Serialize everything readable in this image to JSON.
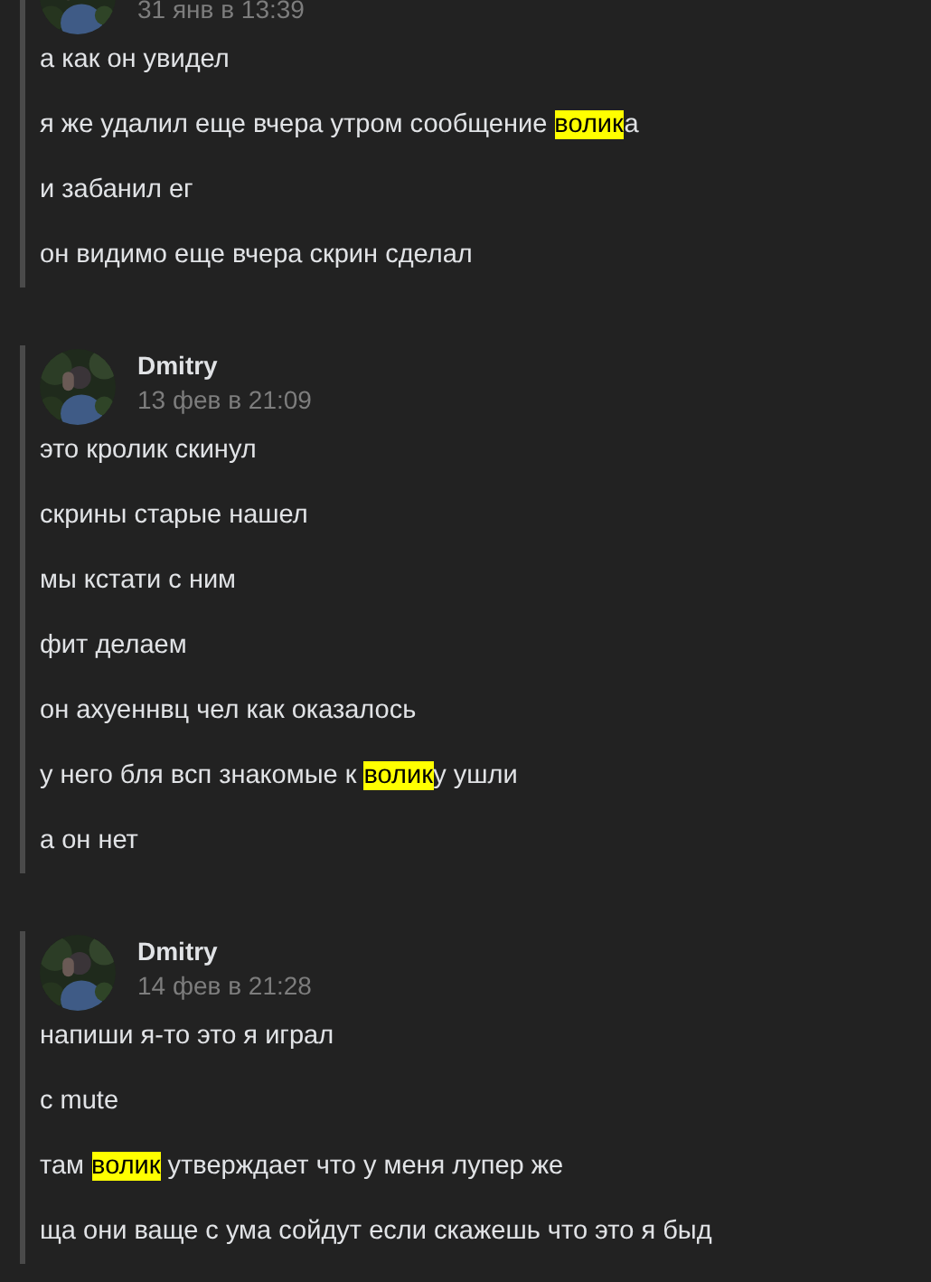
{
  "groups": [
    {
      "time": "31 янв в 13:39",
      "messages": [
        {
          "segments": [
            {
              "text": "а как он увидел",
              "highlight": false
            }
          ]
        },
        {
          "segments": [
            {
              "text": "я же удалил еще вчера утром сообщение ",
              "highlight": false
            },
            {
              "text": "волик",
              "highlight": true
            },
            {
              "text": "а",
              "highlight": false
            }
          ]
        },
        {
          "segments": [
            {
              "text": "и забанил ег",
              "highlight": false
            }
          ]
        },
        {
          "segments": [
            {
              "text": "он видимо еще вчера скрин сделал",
              "highlight": false
            }
          ]
        }
      ]
    },
    {
      "author": "Dmitry",
      "time": "13 фев в 21:09",
      "messages": [
        {
          "segments": [
            {
              "text": "это кролик скинул",
              "highlight": false
            }
          ]
        },
        {
          "segments": [
            {
              "text": "скрины старые нашел",
              "highlight": false
            }
          ]
        },
        {
          "segments": [
            {
              "text": "мы кстати с ним",
              "highlight": false
            }
          ]
        },
        {
          "segments": [
            {
              "text": "фит делаем",
              "highlight": false
            }
          ]
        },
        {
          "segments": [
            {
              "text": "он ахуеннвц чел как оказалось",
              "highlight": false
            }
          ]
        },
        {
          "segments": [
            {
              "text": "у него бля всп знакомые к ",
              "highlight": false
            },
            {
              "text": "волик",
              "highlight": true
            },
            {
              "text": "у ушли",
              "highlight": false
            }
          ]
        },
        {
          "segments": [
            {
              "text": "а он нет",
              "highlight": false
            }
          ]
        }
      ]
    },
    {
      "author": "Dmitry",
      "time": "14 фев в 21:28",
      "messages": [
        {
          "segments": [
            {
              "text": "напиши я-то это я играл",
              "highlight": false
            }
          ]
        },
        {
          "segments": [
            {
              "text": "с mute",
              "highlight": false
            }
          ]
        },
        {
          "segments": [
            {
              "text": "там ",
              "highlight": false
            },
            {
              "text": "волик",
              "highlight": true
            },
            {
              "text": " утверждает что у меня лупер же",
              "highlight": false
            }
          ]
        },
        {
          "segments": [
            {
              "text": "ща они ваще с ума сойдут если скажешь что это я быд",
              "highlight": false
            }
          ]
        }
      ]
    }
  ]
}
